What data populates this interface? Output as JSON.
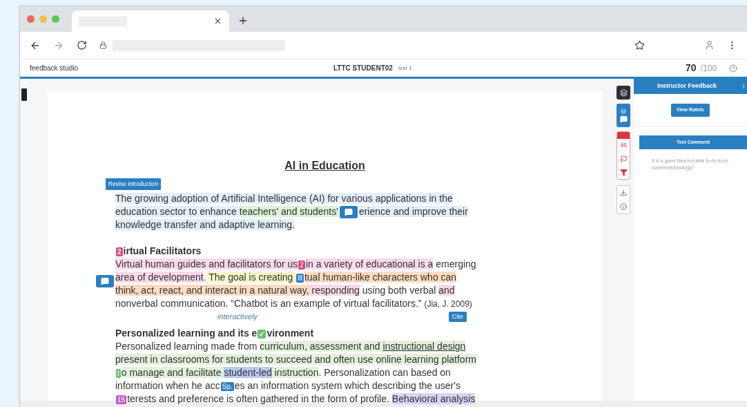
{
  "header": {
    "logo": "feedback studio",
    "student": "LTTC STUDENT02",
    "assignment": "test 1",
    "score": "70",
    "score_max": "/100"
  },
  "document": {
    "title": "AI in Education",
    "sections": [
      {
        "tag": "Revise introduction",
        "lines": [
          [
            {
              "kind": "text",
              "text": "The growing adoption of Artificial Intelligence (AI) for various applications in the",
              "color": "#e3eef8"
            }
          ],
          [
            {
              "kind": "text",
              "text": "education sector to enhance ",
              "color": "#e3eef8"
            },
            {
              "kind": "text",
              "text": "teachers' and students'",
              "color": "#dcf3d6"
            },
            {
              "kind": "comment"
            },
            {
              "kind": "text",
              "text": "erience and improve their",
              "color": "#e3eef8"
            }
          ],
          [
            {
              "kind": "text",
              "text": "knowledge transfer and adaptive learning.",
              "color": "#e3eef8"
            }
          ]
        ]
      },
      {
        "heading": [
          {
            "kind": "marker",
            "label": "2",
            "color": "#e0457b"
          },
          {
            "kind": "text",
            "text": "irtual Facilitators"
          }
        ],
        "lines": [
          [
            {
              "kind": "text",
              "text": "Virtual human guides and facilitators for us",
              "color": "#f9d9ea"
            },
            {
              "kind": "marker",
              "label": "2",
              "color": "#e0457b"
            },
            {
              "kind": "text",
              "text": "in a variety of educational is a",
              "color": "#f9d9ea"
            },
            {
              "kind": "text",
              "text": " emerging"
            }
          ],
          [
            {
              "kind": "text",
              "text": "area of development",
              "color": "#f9d9ea"
            },
            {
              "kind": "text",
              "text": "."
            },
            {
              "kind": "text",
              "text": " The goal is creating ",
              "color": "#f6f7c8"
            },
            {
              "kind": "marker",
              "label": "lll",
              "color": "#2a7fc1"
            },
            {
              "kind": "text",
              "text": "tual human-like characters who can",
              "color": "#fbdcc0"
            }
          ],
          [
            {
              "kind": "text",
              "text": "think, act, react, and interact in a natural way,",
              "color": "#fbdcc0"
            },
            {
              "kind": "text",
              "text": " responding",
              "color": "#f9d9ea"
            },
            {
              "kind": "text",
              "text": " using both verbal "
            },
            {
              "kind": "text",
              "text": "and",
              "color": "#f9d9ea"
            }
          ],
          [
            {
              "kind": "text",
              "text": "nonverbal communication. “Chatbot is an example of virtual facilitators.” "
            },
            {
              "kind": "cite",
              "text": "(Jia, J. 2009)",
              "label": "Cite"
            }
          ]
        ],
        "insertion": "interactively"
      },
      {
        "heading": [
          {
            "kind": "text",
            "text": "Personalized learning and its e"
          },
          {
            "kind": "marker",
            "label": "✓",
            "color": "#6fbf73"
          },
          {
            "kind": "text",
            "text": "vironment"
          }
        ],
        "lines": [
          [
            {
              "kind": "text",
              "text": "Personalized learning made from "
            },
            {
              "kind": "text",
              "text": "curriculum, assessment and ",
              "color": "#e2f1dc"
            },
            {
              "kind": "text",
              "text": "instructional design",
              "color": "#e2f1dc",
              "underline": true
            }
          ],
          [
            {
              "kind": "text",
              "text": "present in classrooms for students to succeed and often use online learning platform",
              "color": "#e2f1dc"
            }
          ],
          [
            {
              "kind": "marker",
              "label": "t",
              "color": "#6fbf73"
            },
            {
              "kind": "text",
              "text": "o manage and facilitate ",
              "color": "#e2f1dc"
            },
            {
              "kind": "text",
              "text": "student-led",
              "color": "#b9c8ef"
            },
            {
              "kind": "text",
              "text": " instruction",
              "color": "#e2f1dc"
            },
            {
              "kind": "text",
              "text": ". Personalization can based on"
            }
          ],
          [
            {
              "kind": "text",
              "text": "information when he acc"
            },
            {
              "kind": "marker",
              "label": "Sp.",
              "color": "#2a7fc1"
            },
            {
              "kind": "text",
              "text": "es an information system which describing the user's"
            }
          ],
          [
            {
              "kind": "marker",
              "label": "15",
              "color": "#c05ec9"
            },
            {
              "kind": "text",
              "text": "terests and preference is often gathered in the form of profile. "
            },
            {
              "kind": "text",
              "text": "Behavioral analysis",
              "color": "#d9d2f5"
            }
          ]
        ]
      }
    ]
  },
  "panel": {
    "title": "Instructor Feedback",
    "rubric_button": "View Rubric",
    "comment_title": "Text Comment",
    "comment": "It is a good idea but able to do so in current technology?"
  },
  "rail": {
    "count": "46"
  }
}
